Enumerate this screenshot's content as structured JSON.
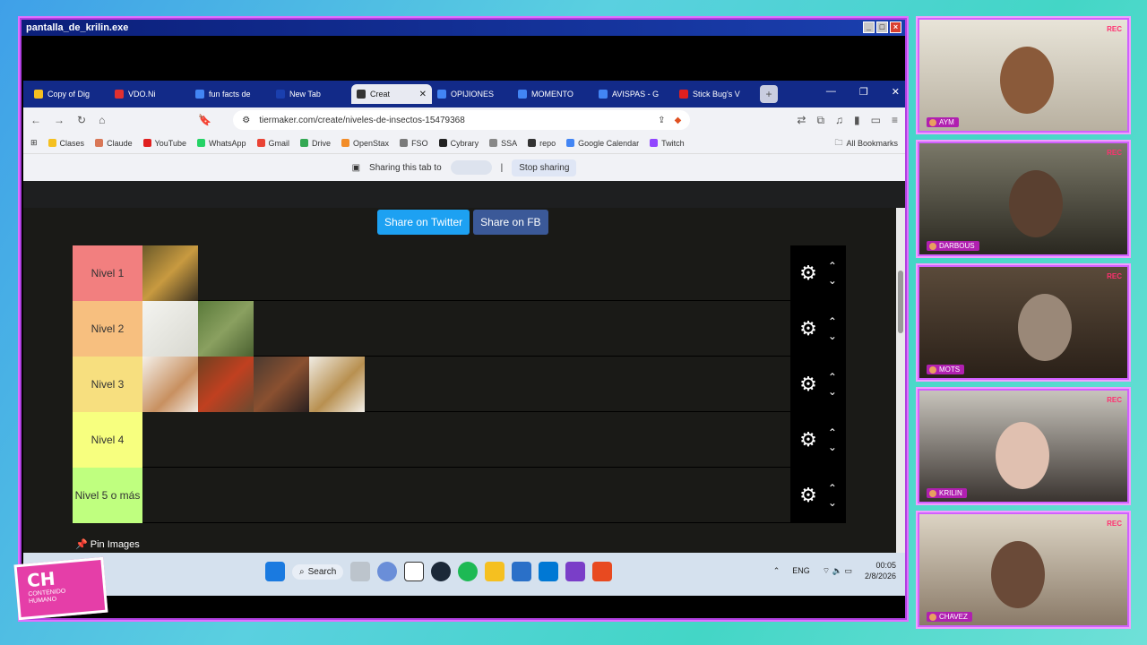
{
  "window": {
    "title": "pantalla_de_krilin.exe"
  },
  "tabs": [
    {
      "label": "Copy of Dig",
      "color": "#f5c020"
    },
    {
      "label": "VDO.Ni",
      "color": "#e03030"
    },
    {
      "label": "fun facts de",
      "color": "#4285f4"
    },
    {
      "label": "New Tab",
      "color": "#1a3fae"
    },
    {
      "label": "Creat",
      "color": "#333333",
      "active": true
    },
    {
      "label": "OPIJIONES",
      "color": "#4285f4"
    },
    {
      "label": "MOMENTO",
      "color": "#4285f4"
    },
    {
      "label": "AVISPAS - G",
      "color": "#4285f4"
    },
    {
      "label": "Stick Bug's V",
      "color": "#e02020"
    }
  ],
  "address": {
    "url": "tiermaker.com/create/niveles-de-insectos-15479368"
  },
  "bookmarks": [
    {
      "label": "Clases",
      "color": "#f5c020"
    },
    {
      "label": "Claude",
      "color": "#d97757"
    },
    {
      "label": "YouTube",
      "color": "#e02020"
    },
    {
      "label": "WhatsApp",
      "color": "#25d366"
    },
    {
      "label": "Gmail",
      "color": "#ea4335"
    },
    {
      "label": "Drive",
      "color": "#34a853"
    },
    {
      "label": "OpenStax",
      "color": "#f28c28"
    },
    {
      "label": "FSO",
      "color": "#7a7a7a"
    },
    {
      "label": "Cybrary",
      "color": "#222222"
    },
    {
      "label": "SSA",
      "color": "#888888"
    },
    {
      "label": "repo",
      "color": "#333333"
    },
    {
      "label": "Google Calendar",
      "color": "#4285f4"
    },
    {
      "label": "Twitch",
      "color": "#9146ff"
    }
  ],
  "bookmarks_all": "All Bookmarks",
  "share_bar": {
    "text": "Sharing this tab to",
    "stop": "Stop sharing"
  },
  "share_buttons": {
    "twitter": "Share on Twitter",
    "facebook": "Share on FB"
  },
  "tiers": [
    {
      "label": "Nivel 1",
      "color": "#f27f7f",
      "items": [
        "wasp"
      ]
    },
    {
      "label": "Nivel 2",
      "color": "#f7bf7f",
      "items": [
        "spider",
        "stick-bug"
      ]
    },
    {
      "label": "Nivel 3",
      "color": "#f7df7f",
      "items": [
        "snail",
        "red-ant",
        "tarantula",
        "scorpion"
      ]
    },
    {
      "label": "Nivel 4",
      "color": "#f7ff7f",
      "items": []
    },
    {
      "label": "Nivel 5 o más",
      "color": "#bfff7f",
      "items": []
    }
  ],
  "pin_images": "Pin Images",
  "taskbar": {
    "search": "Search",
    "lang": "ENG",
    "time": "00:05",
    "date": "2/8/2026"
  },
  "cams": [
    {
      "name": "AYM",
      "rec": "REC"
    },
    {
      "name": "DARBOUS",
      "rec": "REC"
    },
    {
      "name": "MOTS",
      "rec": "REC"
    },
    {
      "name": "KRILIN",
      "rec": "REC"
    },
    {
      "name": "CHAVEZ",
      "rec": "REC"
    }
  ],
  "logo": {
    "big": "CH",
    "small": "CONTENIDO HUMANO"
  }
}
